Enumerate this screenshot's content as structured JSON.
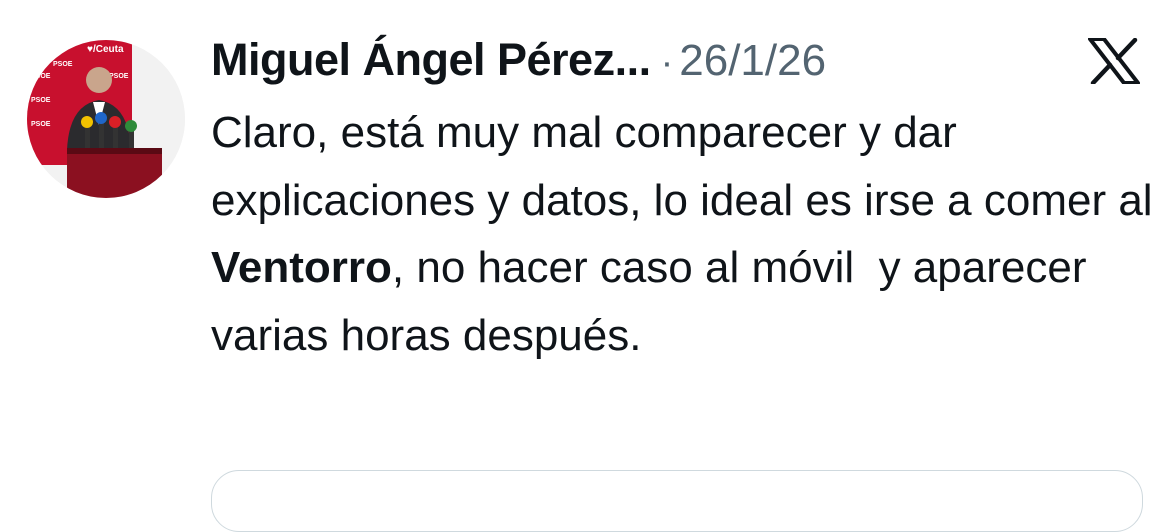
{
  "author": {
    "name": "Miguel Ángel Pérez...",
    "separator": "·",
    "date": "26/1/26"
  },
  "avatar": {
    "backdrop_text": "PSOE",
    "brand_text": "♥/Ceuta"
  },
  "tweet": {
    "text_before": "Claro, está muy mal comparecer y dar explicaciones y datos, lo ideal es irse a comer al ",
    "text_bold": "Ventorro",
    "text_after": ", no hacer caso al móvil  y aparecer varias horas después."
  },
  "icons": {
    "platform_logo": "x-logo-icon"
  },
  "colors": {
    "text": "#0f1419",
    "muted": "#536471",
    "border": "#cfd9de",
    "avatar_red": "#c8102e"
  }
}
